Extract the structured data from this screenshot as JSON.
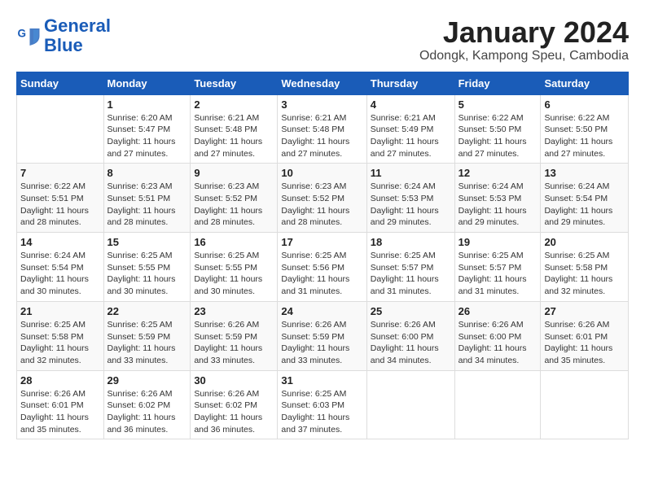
{
  "header": {
    "logo_line1": "General",
    "logo_line2": "Blue",
    "month": "January 2024",
    "location": "Odongk, Kampong Speu, Cambodia"
  },
  "weekdays": [
    "Sunday",
    "Monday",
    "Tuesday",
    "Wednesday",
    "Thursday",
    "Friday",
    "Saturday"
  ],
  "weeks": [
    [
      {
        "day": "",
        "text": ""
      },
      {
        "day": "1",
        "text": "Sunrise: 6:20 AM\nSunset: 5:47 PM\nDaylight: 11 hours\nand 27 minutes."
      },
      {
        "day": "2",
        "text": "Sunrise: 6:21 AM\nSunset: 5:48 PM\nDaylight: 11 hours\nand 27 minutes."
      },
      {
        "day": "3",
        "text": "Sunrise: 6:21 AM\nSunset: 5:48 PM\nDaylight: 11 hours\nand 27 minutes."
      },
      {
        "day": "4",
        "text": "Sunrise: 6:21 AM\nSunset: 5:49 PM\nDaylight: 11 hours\nand 27 minutes."
      },
      {
        "day": "5",
        "text": "Sunrise: 6:22 AM\nSunset: 5:50 PM\nDaylight: 11 hours\nand 27 minutes."
      },
      {
        "day": "6",
        "text": "Sunrise: 6:22 AM\nSunset: 5:50 PM\nDaylight: 11 hours\nand 27 minutes."
      }
    ],
    [
      {
        "day": "7",
        "text": "Sunrise: 6:22 AM\nSunset: 5:51 PM\nDaylight: 11 hours\nand 28 minutes."
      },
      {
        "day": "8",
        "text": "Sunrise: 6:23 AM\nSunset: 5:51 PM\nDaylight: 11 hours\nand 28 minutes."
      },
      {
        "day": "9",
        "text": "Sunrise: 6:23 AM\nSunset: 5:52 PM\nDaylight: 11 hours\nand 28 minutes."
      },
      {
        "day": "10",
        "text": "Sunrise: 6:23 AM\nSunset: 5:52 PM\nDaylight: 11 hours\nand 28 minutes."
      },
      {
        "day": "11",
        "text": "Sunrise: 6:24 AM\nSunset: 5:53 PM\nDaylight: 11 hours\nand 29 minutes."
      },
      {
        "day": "12",
        "text": "Sunrise: 6:24 AM\nSunset: 5:53 PM\nDaylight: 11 hours\nand 29 minutes."
      },
      {
        "day": "13",
        "text": "Sunrise: 6:24 AM\nSunset: 5:54 PM\nDaylight: 11 hours\nand 29 minutes."
      }
    ],
    [
      {
        "day": "14",
        "text": "Sunrise: 6:24 AM\nSunset: 5:54 PM\nDaylight: 11 hours\nand 30 minutes."
      },
      {
        "day": "15",
        "text": "Sunrise: 6:25 AM\nSunset: 5:55 PM\nDaylight: 11 hours\nand 30 minutes."
      },
      {
        "day": "16",
        "text": "Sunrise: 6:25 AM\nSunset: 5:55 PM\nDaylight: 11 hours\nand 30 minutes."
      },
      {
        "day": "17",
        "text": "Sunrise: 6:25 AM\nSunset: 5:56 PM\nDaylight: 11 hours\nand 31 minutes."
      },
      {
        "day": "18",
        "text": "Sunrise: 6:25 AM\nSunset: 5:57 PM\nDaylight: 11 hours\nand 31 minutes."
      },
      {
        "day": "19",
        "text": "Sunrise: 6:25 AM\nSunset: 5:57 PM\nDaylight: 11 hours\nand 31 minutes."
      },
      {
        "day": "20",
        "text": "Sunrise: 6:25 AM\nSunset: 5:58 PM\nDaylight: 11 hours\nand 32 minutes."
      }
    ],
    [
      {
        "day": "21",
        "text": "Sunrise: 6:25 AM\nSunset: 5:58 PM\nDaylight: 11 hours\nand 32 minutes."
      },
      {
        "day": "22",
        "text": "Sunrise: 6:25 AM\nSunset: 5:59 PM\nDaylight: 11 hours\nand 33 minutes."
      },
      {
        "day": "23",
        "text": "Sunrise: 6:26 AM\nSunset: 5:59 PM\nDaylight: 11 hours\nand 33 minutes."
      },
      {
        "day": "24",
        "text": "Sunrise: 6:26 AM\nSunset: 5:59 PM\nDaylight: 11 hours\nand 33 minutes."
      },
      {
        "day": "25",
        "text": "Sunrise: 6:26 AM\nSunset: 6:00 PM\nDaylight: 11 hours\nand 34 minutes."
      },
      {
        "day": "26",
        "text": "Sunrise: 6:26 AM\nSunset: 6:00 PM\nDaylight: 11 hours\nand 34 minutes."
      },
      {
        "day": "27",
        "text": "Sunrise: 6:26 AM\nSunset: 6:01 PM\nDaylight: 11 hours\nand 35 minutes."
      }
    ],
    [
      {
        "day": "28",
        "text": "Sunrise: 6:26 AM\nSunset: 6:01 PM\nDaylight: 11 hours\nand 35 minutes."
      },
      {
        "day": "29",
        "text": "Sunrise: 6:26 AM\nSunset: 6:02 PM\nDaylight: 11 hours\nand 36 minutes."
      },
      {
        "day": "30",
        "text": "Sunrise: 6:26 AM\nSunset: 6:02 PM\nDaylight: 11 hours\nand 36 minutes."
      },
      {
        "day": "31",
        "text": "Sunrise: 6:25 AM\nSunset: 6:03 PM\nDaylight: 11 hours\nand 37 minutes."
      },
      {
        "day": "",
        "text": ""
      },
      {
        "day": "",
        "text": ""
      },
      {
        "day": "",
        "text": ""
      }
    ]
  ]
}
